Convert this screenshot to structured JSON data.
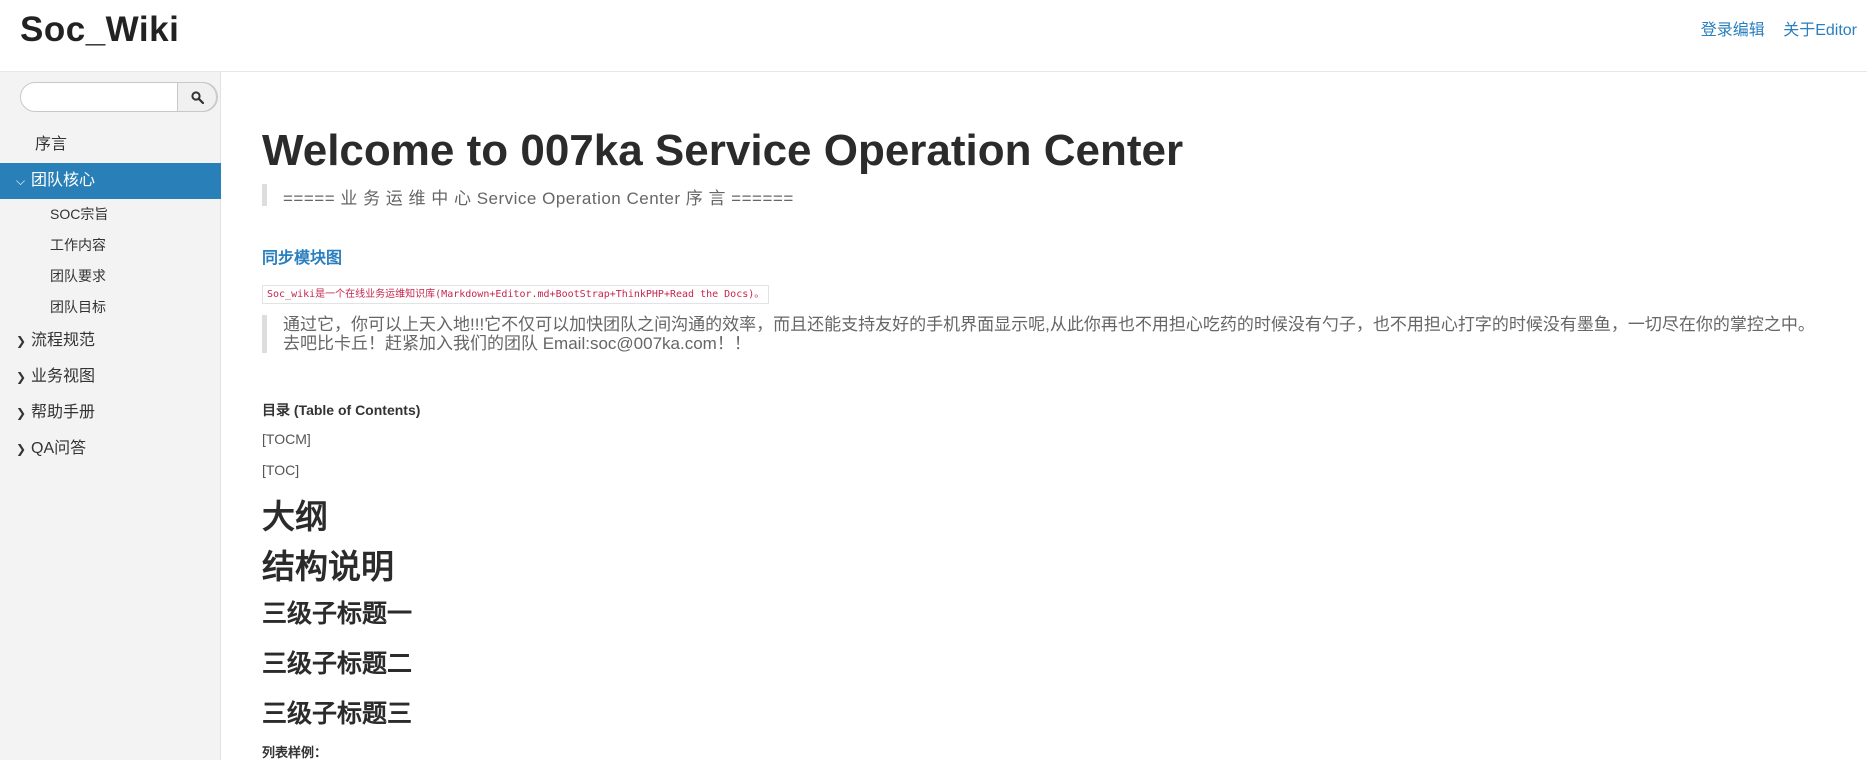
{
  "header": {
    "brand": "Soc_Wiki",
    "links": [
      "登录编辑",
      "关于Editor"
    ]
  },
  "search": {
    "placeholder": "",
    "button_icon": "search-icon"
  },
  "sidebar": {
    "items": [
      {
        "label": "序言"
      },
      {
        "label": "团队核心",
        "active": true,
        "expanded": true,
        "children": [
          "SOC宗旨",
          "工作内容",
          "团队要求",
          "团队目标"
        ]
      },
      {
        "label": "流程规范"
      },
      {
        "label": "业务视图"
      },
      {
        "label": "帮助手册"
      },
      {
        "label": "QA问答"
      }
    ],
    "accent_color": "#2980b9"
  },
  "main": {
    "title": "Welcome to 007ka Service Operation Center",
    "subtitle_quote": "===== 业 务 运 维 中 心 Service Operation Center 序 言 ======",
    "sync_link": "同步模块图",
    "code_line": "Soc_wiki是一个在线业务运维知识库(Markdown+Editor.md+BootStrap+ThinkPHP+Read the Docs)。",
    "quote_lines": [
      "通过它，你可以上天入地!!!它不仅可以加快团队之间沟通的效率，而且还能支持友好的手机界面显示呢,从此你再也不用担心吃药的时候没有勺子，也不用担心打字的时候没有墨鱼，一切尽在你的掌控之中。",
      "去吧比卡丘！赶紧加入我们的团队 Email:soc@007ka.com！！"
    ],
    "toc_label": "目录 (Table of Contents)",
    "tocm": "[TOCM]",
    "toc": "[TOC]",
    "h2_outline": "大纲",
    "h2_structure": "结构说明",
    "h3_items": [
      "三级子标题一",
      "三级子标题二",
      "三级子标题三"
    ],
    "list_sample": "列表样例："
  }
}
